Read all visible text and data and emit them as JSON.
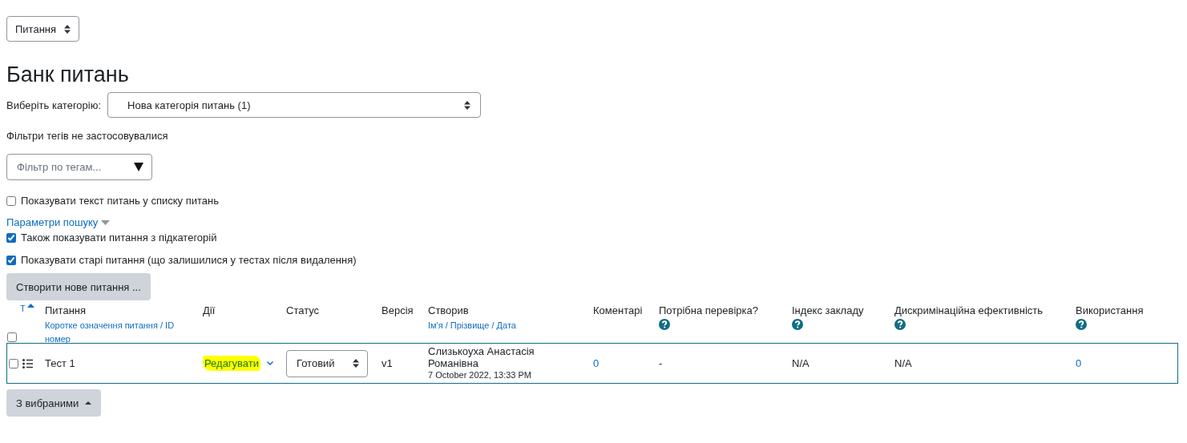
{
  "view_select": {
    "value": "Питання"
  },
  "title": "Банк питань",
  "category": {
    "label": "Виберіть категорію:",
    "value": "Нова категорія питань (1)"
  },
  "tag_filter_note": "Фільтри тегів не застосовувалися",
  "tag_filter": {
    "placeholder": "Фільтр по тегам..."
  },
  "show_text": {
    "label": "Показувати текст питань у списку питань",
    "checked": false
  },
  "search_options": {
    "label": "Параметри пошуку",
    "expanded": false
  },
  "options": [
    {
      "label": "Також показувати питання з підкатегорій",
      "checked": true
    },
    {
      "label": "Показувати старі питання (що залишилися у тестах після видалення)",
      "checked": true
    }
  ],
  "create_button": "Створити нове питання ...",
  "table": {
    "sort_marker": "T",
    "select_all": {
      "checked": false
    },
    "columns": [
      {
        "title": "Питання",
        "subtitle": "Коротке означення питання / ID номер",
        "help": false
      },
      {
        "title": "Дії",
        "help": false
      },
      {
        "title": "Статус",
        "help": false
      },
      {
        "title": "Версія",
        "help": false
      },
      {
        "title": "Створив",
        "subtitle": "Ім'я / Прізвище / Дата",
        "help": false
      },
      {
        "title": "Коментарі",
        "help": false
      },
      {
        "title": "Потрібна перевірка?",
        "help": true
      },
      {
        "title": "Індекс закладу",
        "help": true
      },
      {
        "title": "Дискримінаційна ефективність",
        "help": true
      },
      {
        "title": "Використання",
        "help": true
      }
    ],
    "rows": [
      {
        "checked": false,
        "name": "Тест 1",
        "action": "Редагувати",
        "action_highlighted": true,
        "status": "Готовий",
        "version": "v1",
        "creator": "Слизькоуха Анастасія Романівна",
        "date": "7 October 2022, 13:33 PM",
        "comments": "0",
        "needs_check": "-",
        "facility_index": "N/A",
        "discrimination": "N/A",
        "usage": "0"
      }
    ]
  },
  "bulk_button": "З вибраними"
}
